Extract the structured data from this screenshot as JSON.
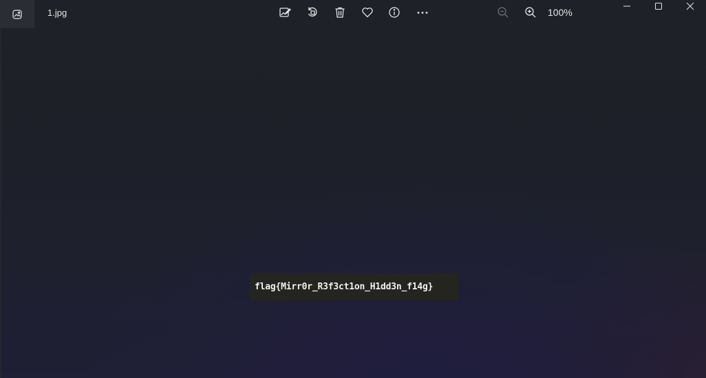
{
  "titlebar": {
    "filename": "1.jpg",
    "zoom_level": "100%"
  },
  "toolbar": {
    "icons": [
      "edit-image-icon",
      "rotate-icon",
      "delete-icon",
      "favorite-heart-icon",
      "info-icon",
      "more-options-icon",
      "zoom-out-icon",
      "zoom-in-icon"
    ]
  },
  "window_controls": [
    "minimize-icon",
    "maximize-icon",
    "close-icon"
  ],
  "image_content": {
    "text": "flag{Mirr0r_R3f3ct1on_H1dd3n_f14g}"
  }
}
